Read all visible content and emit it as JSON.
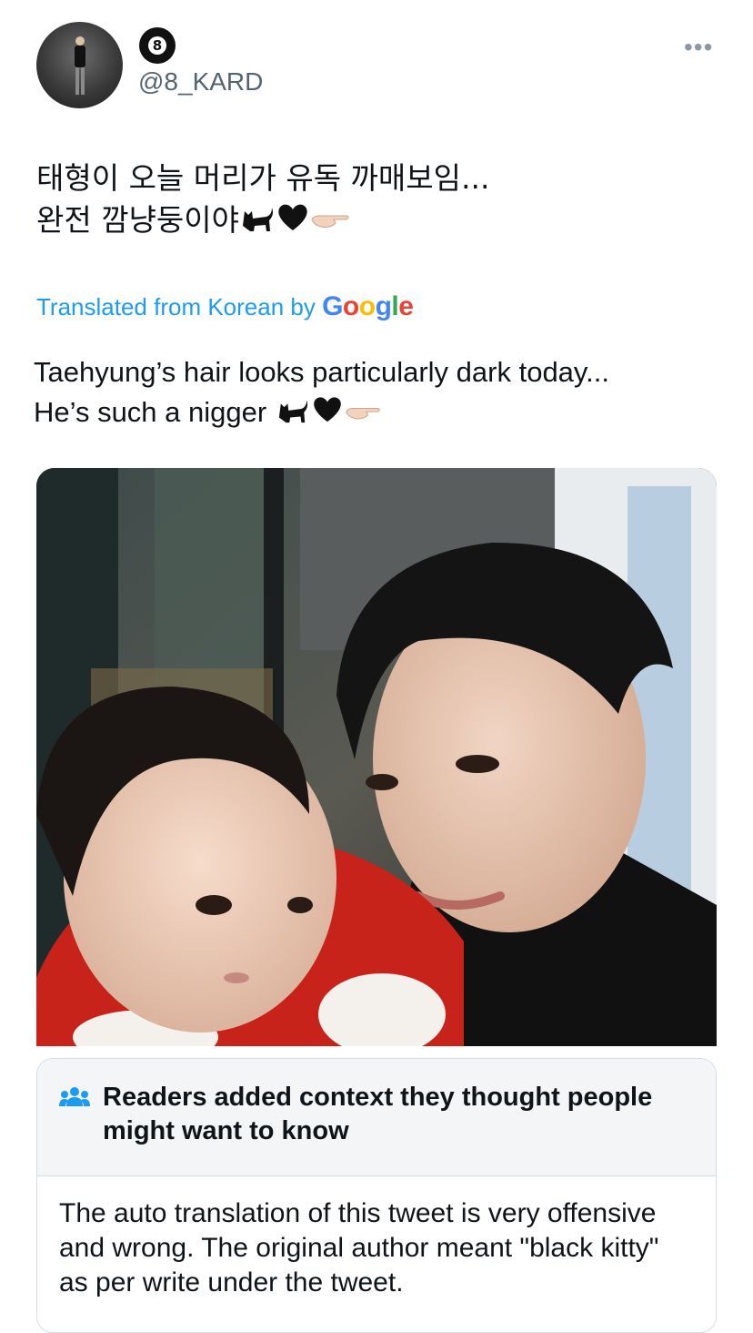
{
  "tweet": {
    "handle": "@8_KARD",
    "name_badge": "8",
    "more_label": "•••",
    "korean_lines": [
      "태형이 오늘 머리가 유독 까매보임...",
      "완전 깜냥둥이야"
    ],
    "translated_prefix": "Translated from Korean by ",
    "google_letters": [
      "G",
      "o",
      "o",
      "g",
      "l",
      "e"
    ],
    "english_lines": [
      "Taehyung’s hair looks particularly dark today...",
      "He’s such a nigger "
    ],
    "emoji_icons": [
      "black-cat-icon",
      "black-heart-icon",
      "pointing-hand-icon"
    ]
  },
  "note": {
    "title": "Readers added context they thought people might want to know",
    "body": "The auto translation of this tweet is very offensive and wrong. The original author meant \"black kitty\" as per write under the tweet."
  },
  "colors": {
    "link_blue": "#1d9bf0",
    "muted": "#536471",
    "google": [
      "#4285f4",
      "#ea4335",
      "#fbbc05",
      "#4285f4",
      "#34a853",
      "#ea4335"
    ]
  }
}
